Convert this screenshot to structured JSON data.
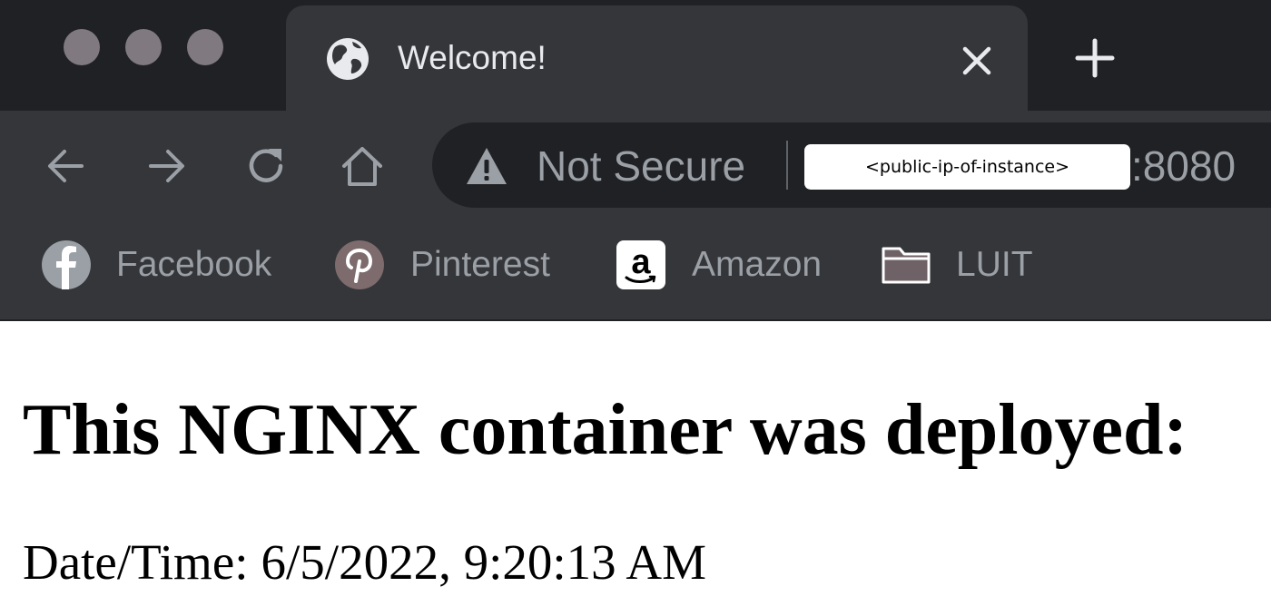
{
  "window": {
    "traffic_lights": [
      "close",
      "minimize",
      "maximize"
    ]
  },
  "tab": {
    "title": "Welcome!",
    "favicon": "globe-icon",
    "close_icon": "close-icon",
    "new_tab_icon": "plus-icon"
  },
  "toolbar": {
    "back_icon": "arrow-left-icon",
    "forward_icon": "arrow-right-icon",
    "reload_icon": "reload-icon",
    "home_icon": "home-icon"
  },
  "address_bar": {
    "security_icon": "warning-icon",
    "security_label": "Not Secure",
    "host": "<public-ip-of-instance>",
    "port": ":8080"
  },
  "bookmarks": [
    {
      "label": "Facebook",
      "icon": "facebook-icon"
    },
    {
      "label": "Pinterest",
      "icon": "pinterest-icon"
    },
    {
      "label": "Amazon",
      "icon": "amazon-icon"
    },
    {
      "label": "LUIT",
      "icon": "folder-icon"
    }
  ],
  "page": {
    "heading": "This NGINX container was deployed:",
    "datetime_label": "Date/Time:",
    "datetime_value": "6/5/2022, 9:20:13 AM"
  },
  "colors": {
    "tabstrip": "#202124",
    "toolbar": "#35363a",
    "chrome_text": "#9aa0a6",
    "tab_text": "#e8eaed",
    "traffic_light": "#807a80",
    "page_background": "#ffffff",
    "page_text": "#000000"
  }
}
